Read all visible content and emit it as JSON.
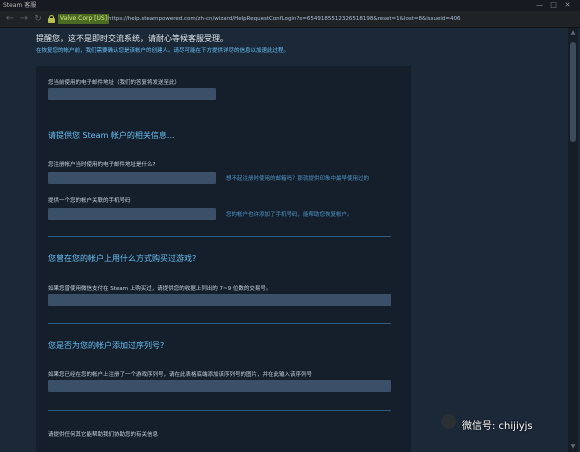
{
  "window": {
    "title": "Steam 客服",
    "minimize_icon": "minimize-icon",
    "maximize_icon": "maximize-icon",
    "close_icon": "close-icon"
  },
  "navbar": {
    "ev_badge": "Valve Corp [US]",
    "url": "https://help.steampowered.com/zh-cn/wizard/HelpRequestConfLogin?s=6549185512326518198&reset=1&lost=8&issueid=406"
  },
  "intro": {
    "title": "提醒您，这不是即时交流系统，请耐心等候客服受理。",
    "subtitle": "在恢复您的帐户前，我们需要确认您是该帐户的创建人。请尽可能在下方提供详尽的信息以加速此过程。"
  },
  "form": {
    "email_label": "您当前使用的电子邮件地址（我们的答复将发送至此）",
    "account_section": "请提供您 Steam 帐户的相关信息...",
    "signup_email_label": "您注册帐户当时使用的电子邮件地址是什么?",
    "signup_email_hint": "想不起注册时使用的邮箱吗？那就提供印象中最早使用过的",
    "phone_label": "提供一个您的帐户关联的手机号码",
    "phone_hint": "您的帐户也许添加了手机号码，能帮助您恢复帐户。",
    "purchase_section": "您曾在您的帐户上用什么方式购买过游戏?",
    "purchase_label": "如果您曾使用微信支付在 Steam 上购买过，请提供您的收据上列出的 7~9 位数的交易号。",
    "product_key_section": "您是否为您的帐户添加过序列号?",
    "product_key_label": "如果您已经在您的帐户上注册了一个游戏序列号，请在此表格底端添加该序列号的图片，并在此输入该序列号",
    "other_info_label": "请提供任何其它能帮助我们协助您的有关信息"
  },
  "watermark": {
    "text": "微信号: chijiyjs"
  }
}
